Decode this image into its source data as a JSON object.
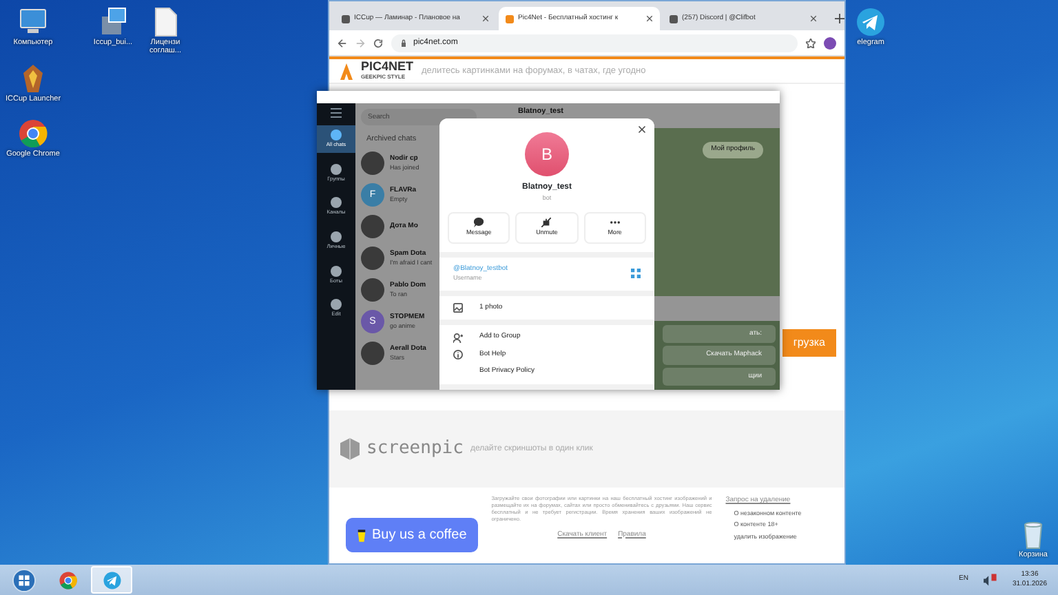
{
  "desktop_icons": [
    {
      "label": "Компьютер",
      "kind": "computer"
    },
    {
      "label": "Iccup_bui...",
      "kind": "installer"
    },
    {
      "label": "Лицензи соглаш...",
      "kind": "document"
    },
    {
      "label": "ICCup Launcher",
      "kind": "game"
    },
    {
      "label": "Google Chrome",
      "kind": "chrome"
    },
    {
      "label": "elegram",
      "kind": "telegram"
    },
    {
      "label": "Корзина",
      "kind": "bin"
    }
  ],
  "chrome": {
    "tabs": [
      {
        "title": "ICCup — Ламинар - Плановое на",
        "selected": false
      },
      {
        "title": "Pic4Net - Бесплатный хостинг к",
        "selected": true
      },
      {
        "title": "(257) Discord | @Clifbot",
        "selected": false
      }
    ],
    "address": "pic4net.com",
    "site": {
      "logo": "PIC4NET",
      "logo_sub": "GEEKPIC STYLE",
      "tagline": "делитесь картинками на форумах, в чатах, где угодно",
      "upload_button": "грузка",
      "screenpic_logo": "screenpic",
      "screenpic_tagline": "делайте скриншоты в один клик",
      "coffee_button": "Buy us a coffee",
      "footer_text": "Загружайте свои фотографии или картинки на наш бесплатный хостинг изображений и размещайте их на форумах, сайтах или просто обменивайтесь с друзьями. Наш сервис бесплатный и не требует регистрации. Время хранения ваших изображений не ограничено.",
      "footer_links": [
        "Скачать клиент",
        "Правила"
      ],
      "report_link": "Запрос на удаление",
      "report_items": [
        "О незаконном контенте",
        "О контенте 18+",
        "удалить изображение"
      ]
    }
  },
  "telegram": {
    "sidebar": [
      {
        "label": "All chats",
        "selected": true
      },
      {
        "label": "Группы",
        "selected": false
      },
      {
        "label": "Каналы",
        "selected": false
      },
      {
        "label": "Личные",
        "selected": false
      },
      {
        "label": "Боты",
        "selected": false
      },
      {
        "label": "Edit",
        "selected": false
      }
    ],
    "search_placeholder": "Search",
    "archived": "Archived chats",
    "chats": [
      {
        "name": "Nodir сp",
        "preview": "Has joined",
        "kind": "photo"
      },
      {
        "name": "FLAVRa",
        "preview": "Empty",
        "kind": "letter",
        "letter": "F",
        "color": "#3a7ea6"
      },
      {
        "name": "Дота Mo",
        "kind": "photo"
      },
      {
        "name": "Spam Dota",
        "preview": "I'm afraid I cant",
        "kind": "photo"
      },
      {
        "name": "Pablo Dom",
        "preview": "To ran",
        "kind": "photo"
      },
      {
        "name": "STOPMEM",
        "preview": "go anime",
        "kind": "letter",
        "letter": "S",
        "color": "#6a58a8"
      },
      {
        "name": "Aerall Dota",
        "preview": "Stars",
        "kind": "photo"
      }
    ],
    "chat_title": "Blatnoy_test",
    "message": "Мой профиль",
    "keyboard": [
      "ать:",
      "Скачать Maphack",
      "щии"
    ]
  },
  "profile": {
    "avatar_letter": "B",
    "name": "Blatnoy_test",
    "status": "bot",
    "actions": [
      {
        "label": "Message",
        "kind": "message"
      },
      {
        "label": "Unmute",
        "kind": "unmute"
      },
      {
        "label": "More",
        "kind": "more"
      }
    ],
    "username": "@Blatnoy_testbot",
    "username_label": "Username",
    "media": "1 photo",
    "menu": [
      {
        "label": "Add to Group",
        "kind": "add"
      },
      {
        "label": "Bot Help",
        "kind": "help"
      },
      {
        "label": "Bot Privacy Policy",
        "kind": "none"
      }
    ]
  },
  "taskbar": {
    "apps": [
      {
        "kind": "chrome",
        "active": false
      },
      {
        "kind": "telegram",
        "active": true
      }
    ],
    "language": "EN",
    "time": "13:36",
    "date": "31.01.2026"
  }
}
